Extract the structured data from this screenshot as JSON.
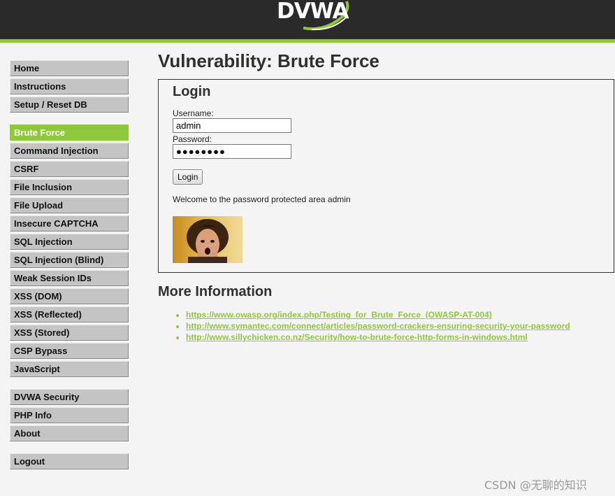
{
  "header": {
    "logo_text": "DVWA"
  },
  "menu": {
    "groups": [
      [
        {
          "label": "Home"
        },
        {
          "label": "Instructions"
        },
        {
          "label": "Setup / Reset DB"
        }
      ],
      [
        {
          "label": "Brute Force"
        },
        {
          "label": "Command Injection"
        },
        {
          "label": "CSRF"
        },
        {
          "label": "File Inclusion"
        },
        {
          "label": "File Upload"
        },
        {
          "label": "Insecure CAPTCHA"
        },
        {
          "label": "SQL Injection"
        },
        {
          "label": "SQL Injection (Blind)"
        },
        {
          "label": "Weak Session IDs"
        },
        {
          "label": "XSS (DOM)"
        },
        {
          "label": "XSS (Reflected)"
        },
        {
          "label": "XSS (Stored)"
        },
        {
          "label": "CSP Bypass"
        },
        {
          "label": "JavaScript"
        }
      ],
      [
        {
          "label": "DVWA Security"
        },
        {
          "label": "PHP Info"
        },
        {
          "label": "About"
        }
      ],
      [
        {
          "label": "Logout"
        }
      ]
    ],
    "selected": "Brute Force"
  },
  "main": {
    "title": "Vulnerability: Brute Force",
    "login": {
      "heading": "Login",
      "username_label": "Username:",
      "username_value": "admin",
      "password_label": "Password:",
      "password_value": "●●●●●●●●",
      "button_label": "Login",
      "welcome": "Welcome to the password protected area admin"
    },
    "more_info": {
      "heading": "More Information",
      "links": [
        "https://www.owasp.org/index.php/Testing_for_Brute_Force_(OWASP-AT-004)",
        "http://www.symantec.com/connect/articles/password-crackers-ensuring-security-your-password",
        "http://www.sillychicken.co.nz/Security/how-to-brute-force-http-forms-in-windows.html"
      ]
    }
  },
  "watermark": "CSDN @无聊的知识",
  "colors": {
    "accent": "#8fc93a",
    "header": "#2a2a2a",
    "background": "#f4f4f4"
  }
}
